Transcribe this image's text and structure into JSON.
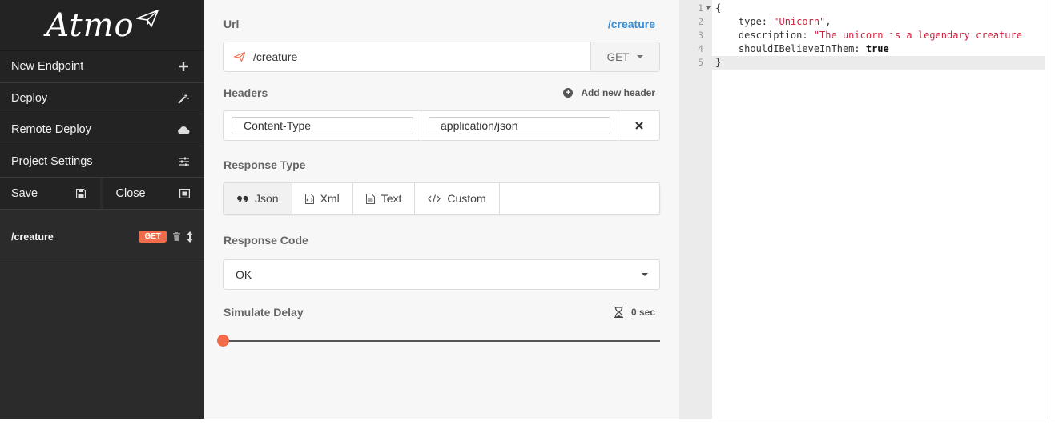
{
  "app": {
    "logo_text": "Atmo"
  },
  "sidebar": {
    "menu": [
      {
        "label": "New Endpoint",
        "icon": "plus-icon"
      },
      {
        "label": "Deploy",
        "icon": "magic-wand-icon"
      },
      {
        "label": "Remote Deploy",
        "icon": "cloud-icon"
      },
      {
        "label": "Project Settings",
        "icon": "sliders-icon"
      }
    ],
    "save_label": "Save",
    "close_label": "Close",
    "endpoints": [
      {
        "path": "/creature",
        "method": "GET"
      }
    ]
  },
  "main": {
    "url_label": "Url",
    "url_link": "/creature",
    "url_value": "/creature",
    "method_value": "GET",
    "headers_label": "Headers",
    "add_header_label": "Add new header",
    "headers": [
      {
        "key": "Content-Type",
        "value": "application/json"
      }
    ],
    "response_type_label": "Response Type",
    "response_types": [
      {
        "label": "Json",
        "icon": "quote-icon",
        "active": true
      },
      {
        "label": "Xml",
        "icon": "xml-file-icon",
        "active": false
      },
      {
        "label": "Text",
        "icon": "text-file-icon",
        "active": false
      },
      {
        "label": "Custom",
        "icon": "code-icon",
        "active": false
      }
    ],
    "response_code_label": "Response Code",
    "response_code_value": "OK",
    "delay_label": "Simulate Delay",
    "delay_value": "0 sec",
    "delay_fraction": 0
  },
  "editor": {
    "line_numbers": [
      "1",
      "2",
      "3",
      "4",
      "5"
    ],
    "lines": [
      {
        "tokens": [
          {
            "t": "{",
            "c": "tok-key"
          }
        ]
      },
      {
        "tokens": [
          {
            "t": "    type: ",
            "c": "tok-key"
          },
          {
            "t": "\"Unicorn\"",
            "c": "tok-str"
          },
          {
            "t": ",",
            "c": "tok-key"
          }
        ]
      },
      {
        "tokens": [
          {
            "t": "    description: ",
            "c": "tok-key"
          },
          {
            "t": "\"The unicorn is a legendary creature",
            "c": "tok-str"
          }
        ]
      },
      {
        "tokens": [
          {
            "t": "    shouldIBelieveInThem: ",
            "c": "tok-key"
          },
          {
            "t": "true",
            "c": "tok-bool"
          }
        ]
      },
      {
        "tokens": [
          {
            "t": "}",
            "c": "tok-key"
          }
        ]
      }
    ],
    "active_line": 5
  },
  "colors": {
    "accent": "#f26b4a",
    "link": "#3b8ed1",
    "sidebar_bg": "#2b2b2b"
  }
}
